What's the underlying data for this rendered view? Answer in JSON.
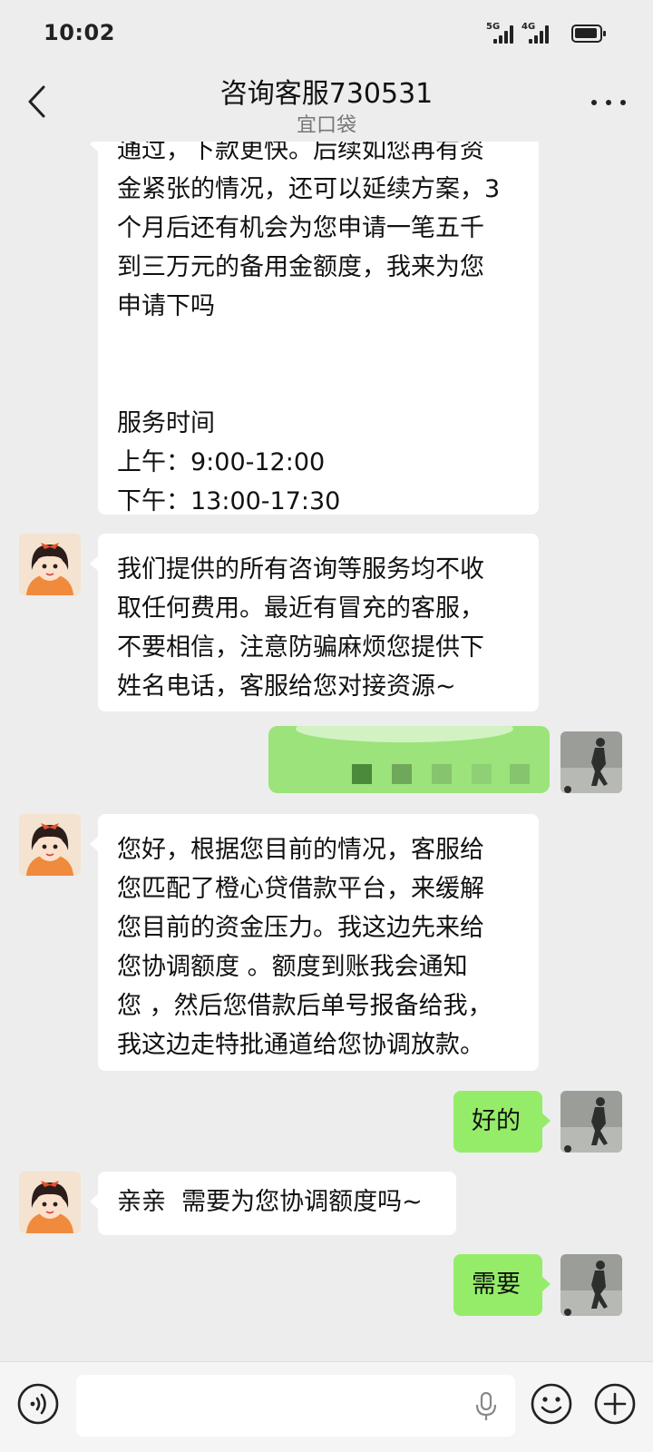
{
  "status_bar": {
    "time": "10:02",
    "signal_1_label": "5G",
    "signal_2_label": "4G"
  },
  "header": {
    "title": "咨询客服730531",
    "subtitle": "宜口袋"
  },
  "messages": [
    {
      "from": "agent",
      "text": "通过，下款更快。后续如您再有资\n金紧张的情况，还可以延续方案，3\n个月后还有机会为您申请一笔五千\n到三万元的备用金额度，我来为您\n申请下吗\n\n\n服务时间\n上午：9:00-12:00\n下午：13:00-17:30"
    },
    {
      "from": "agent",
      "text": "我们提供的所有咨询等服务均不收\n取任何费用。最近有冒充的客服，\n不要相信，注意防骗麻烦您提供下\n姓名电话，客服给您对接资源~"
    },
    {
      "from": "me",
      "text": ""
    },
    {
      "from": "agent",
      "text": "您好，根据您目前的情况，客服给\n您匹配了橙心贷借款平台，来缓解\n您目前的资金压力。我这边先来给\n您协调额度 。额度到账我会通知\n您 ，然后您借款后单号报备给我，\n我这边走特批通道给您协调放款。"
    },
    {
      "from": "me",
      "text": "好的"
    },
    {
      "from": "agent",
      "text": "亲亲  需要为您协调额度吗~"
    },
    {
      "from": "me",
      "text": "需要"
    }
  ],
  "input": {
    "placeholder": ""
  },
  "colors": {
    "background": "#ededed",
    "incoming_bubble": "#ffffff",
    "outgoing_bubble": "#95ec69"
  },
  "icons": [
    "back-arrow-icon",
    "more-dots-icon",
    "voice-icon",
    "microphone-icon",
    "emoji-icon",
    "add-icon"
  ]
}
